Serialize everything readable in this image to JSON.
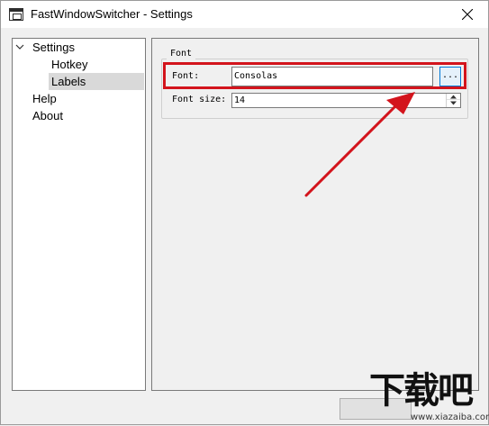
{
  "window": {
    "title": "FastWindowSwitcher - Settings"
  },
  "tree": {
    "items": [
      {
        "label": "Settings",
        "expanded": true
      },
      {
        "label": "Hotkey"
      },
      {
        "label": "Labels",
        "selected": true
      },
      {
        "label": "Help"
      },
      {
        "label": "About"
      }
    ]
  },
  "font_group": {
    "title": "Font",
    "font_label": "Font:",
    "font_value": "Consolas",
    "browse_label": "...",
    "size_label": "Font size:",
    "size_value": "14"
  },
  "annotation": {
    "highlight_color": "#d3141c",
    "arrow_color": "#d3141c"
  },
  "watermark": {
    "text": "下载吧",
    "url": "www.xiazaiba.com"
  },
  "icons": {
    "app": "window-icon",
    "close": "close-icon",
    "expand": "chevron-down-icon",
    "spin_up": "triangle-up-icon",
    "spin_down": "triangle-down-icon"
  }
}
